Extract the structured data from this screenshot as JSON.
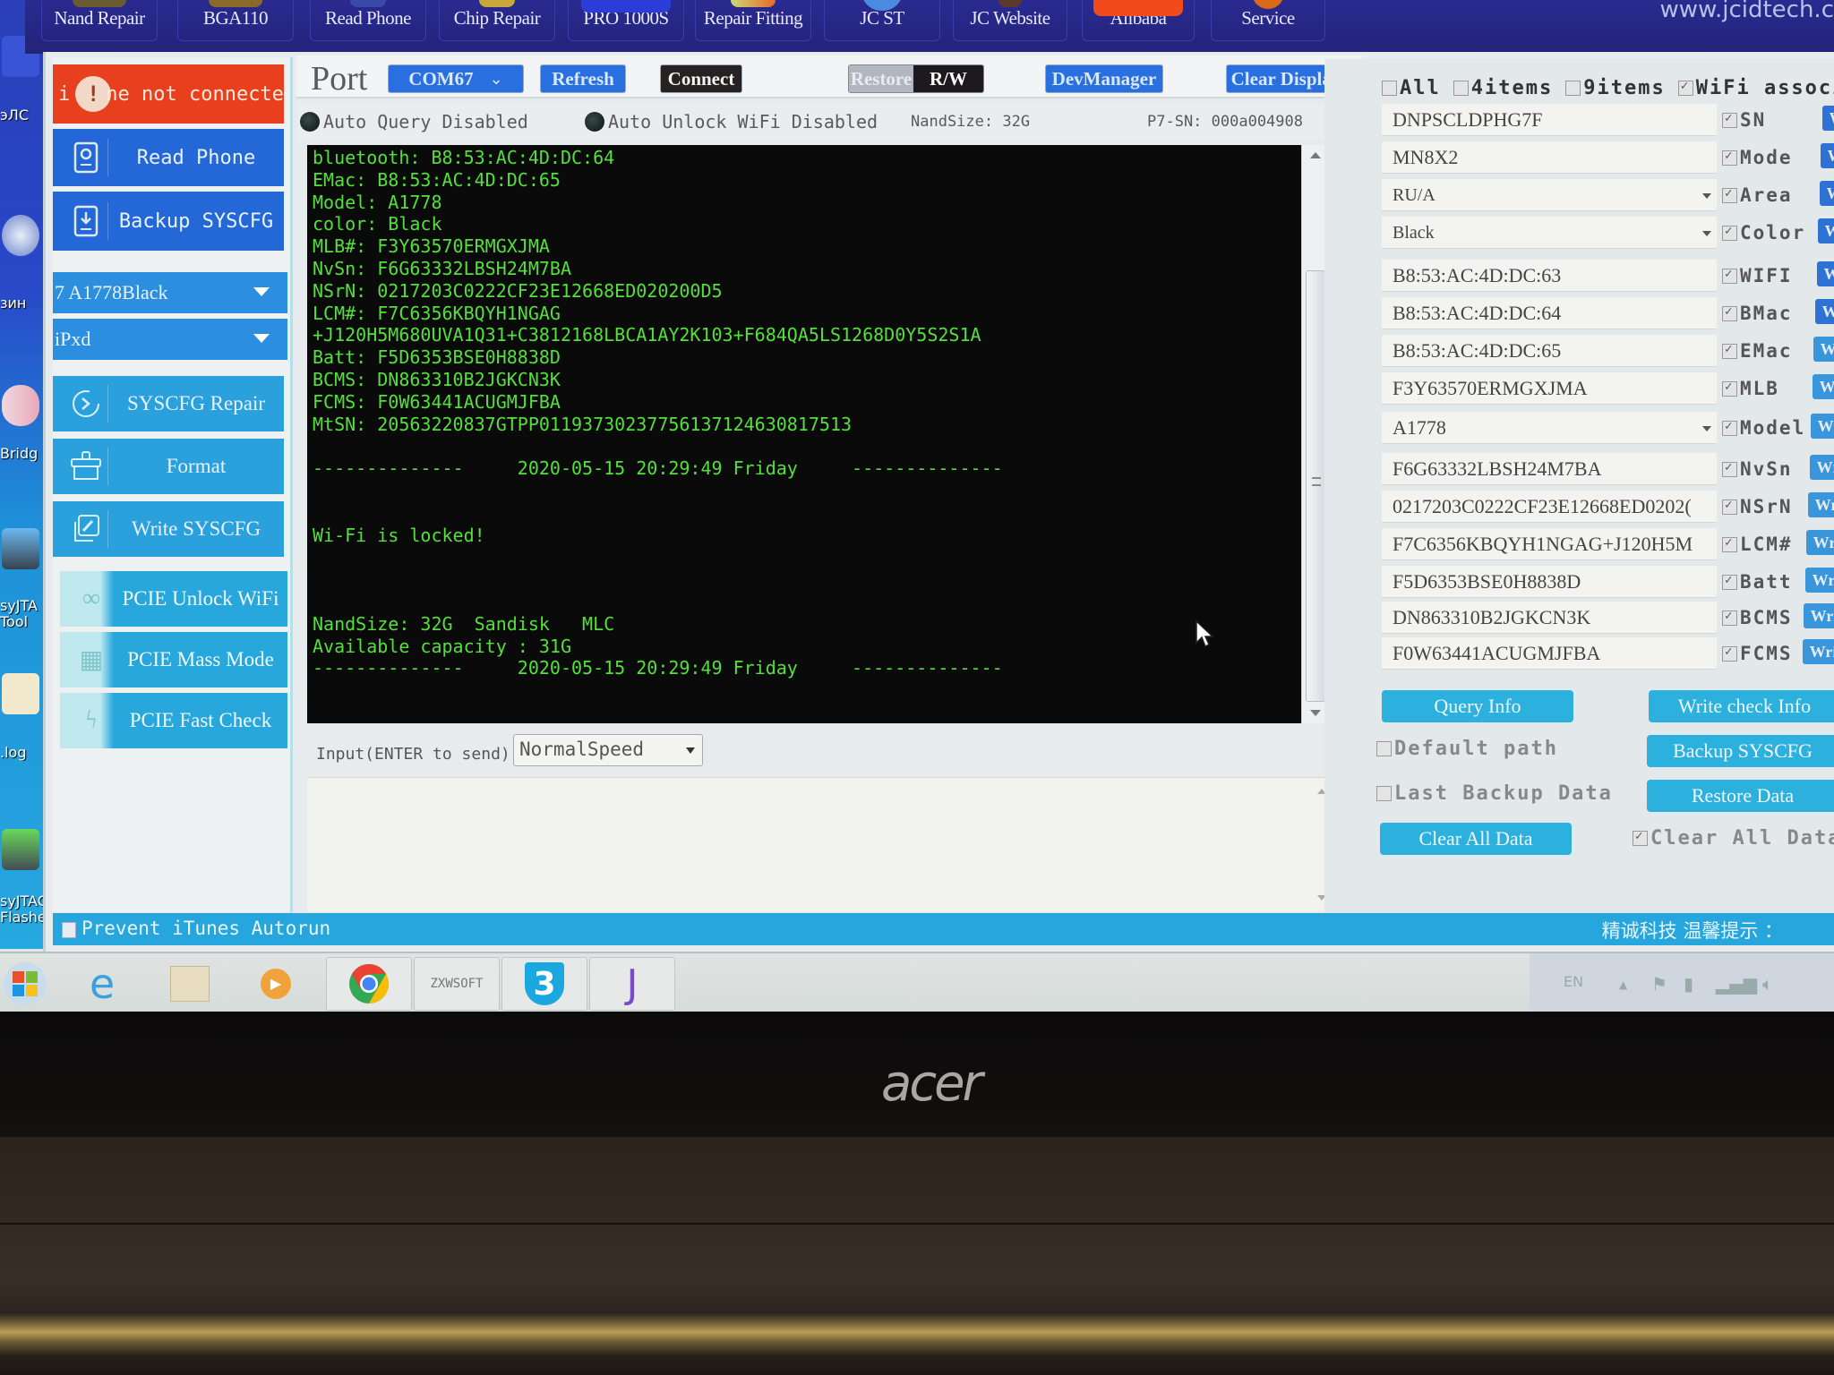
{
  "desktop": {
    "labels": [
      "эЛС",
      "зин",
      "Bridg",
      "syJTA\nTool",
      ".log",
      "syJTAG\nFlashe"
    ]
  },
  "top_menu": {
    "items": [
      {
        "label": "Nand Repair",
        "icon": "nand-repair-icon"
      },
      {
        "label": "BGA110",
        "icon": "bga-icon"
      },
      {
        "label": "Read Phone",
        "icon": "read-phone-icon"
      },
      {
        "label": "Chip Repair",
        "icon": "chip-icon"
      },
      {
        "label": "PRO 1000S",
        "icon": "pro-1000s-icon"
      },
      {
        "label": "Repair Fitting",
        "icon": "repair-fitting-icon"
      },
      {
        "label": "JC ST",
        "icon": "jc-st-icon"
      },
      {
        "label": "JC Website",
        "icon": "jc-website-icon"
      },
      {
        "label": "Alibaba",
        "icon": "alibaba-icon"
      },
      {
        "label": "Service",
        "icon": "service-icon"
      }
    ],
    "url": "www.jcidtech.c"
  },
  "sidebar": {
    "status": {
      "prefix": "i",
      "text": "ne not connecte",
      "color": "#e83f1e"
    },
    "buttons_top": [
      {
        "label": "Read Phone",
        "icon": "read-phone-icon"
      },
      {
        "label": "Backup SYSCFG",
        "icon": "download-icon"
      }
    ],
    "model_select": "7 A1778Black",
    "device_select": "iPxd",
    "buttons_mid": [
      {
        "label": "SYSCFG Repair",
        "icon": "arrow-circle-icon"
      },
      {
        "label": "Format",
        "icon": "brush-icon"
      },
      {
        "label": "Write SYSCFG",
        "icon": "edit-copy-icon"
      }
    ],
    "buttons_pcie": [
      {
        "label": "PCIE Unlock WiFi",
        "icon": "link-icon"
      },
      {
        "label": "PCIE Mass Mode",
        "icon": "grid-check-icon"
      },
      {
        "label": "PCIE Fast Check",
        "icon": "lightning-bubble-icon"
      }
    ]
  },
  "toolbar": {
    "port_label": "Port",
    "com_port": "COM67",
    "refresh": "Refresh",
    "connect": "Connect",
    "restore": "Restore",
    "rw": "R/W",
    "devmanager": "DevManager",
    "clear_display": "Clear Display"
  },
  "statusline": {
    "auto_query": "Auto Query Disabled",
    "auto_unlock": "Auto Unlock WiFi Disabled",
    "nand_size": "NandSize: 32G",
    "p7_sn": "P7-SN: 000a004908"
  },
  "console": {
    "lines": [
      "bluetooth: B8:53:AC:4D:DC:64",
      "EMac: B8:53:AC:4D:DC:65",
      "Model: A1778",
      "color: Black",
      "MLB#: F3Y63570ERMGXJMA",
      "NvSn: F6G63332LBSH24M7BA",
      "NSrN: 0217203C0222CF23E12668ED020200D5",
      "LCM#: F7C6356KBQYH1NGAG",
      "+J120H5M680UVA1Q31+C3812168LBCA1AY2K103+F684QA5LS1268D0Y5S2S1A",
      "Batt: F5D6353BSE0H8838D",
      "BCMS: DN863310B2JGKCN3K",
      "FCMS: F0W63441ACUGMJFBA",
      "MtSN: 20563220837GTPP01193730237756137124630817513",
      "",
      "--------------     2020-05-15 20:29:49 Friday     --------------",
      "",
      "",
      "Wi-Fi is locked!",
      "",
      "",
      "",
      "NandSize: 32G  Sandisk   MLC",
      "Available capacity : 31G",
      "--------------     2020-05-15 20:29:49 Friday     --------------"
    ],
    "text_color": "#53e03a"
  },
  "input": {
    "label": "Input(ENTER to send)",
    "speed": "NormalSpeed"
  },
  "right_panel": {
    "select_options": [
      {
        "label": "All",
        "checked": false
      },
      {
        "label": "4items",
        "checked": false
      },
      {
        "label": "9items",
        "checked": false
      },
      {
        "label": "WiFi associa",
        "checked": true
      }
    ],
    "fields": [
      {
        "value": "DNPSCLDPHG7F",
        "label": "SN",
        "checked": true,
        "dropdown": false
      },
      {
        "value": "MN8X2",
        "label": "Mode",
        "checked": true,
        "dropdown": false
      },
      {
        "value": "RU/A",
        "label": "Area",
        "checked": true,
        "dropdown": true
      },
      {
        "value": "Black",
        "label": "Color",
        "checked": true,
        "dropdown": true
      },
      {
        "value": "B8:53:AC:4D:DC:63",
        "label": "WIFI",
        "checked": true,
        "dropdown": false
      },
      {
        "value": "B8:53:AC:4D:DC:64",
        "label": "BMac",
        "checked": true,
        "dropdown": false
      },
      {
        "value": "B8:53:AC:4D:DC:65",
        "label": "EMac",
        "checked": true,
        "dropdown": false
      },
      {
        "value": "F3Y63570ERMGXJMA",
        "label": "MLB",
        "checked": true,
        "dropdown": false
      },
      {
        "value": "A1778",
        "label": "Model",
        "checked": true,
        "dropdown": true
      },
      {
        "value": "F6G63332LBSH24M7BA",
        "label": "NvSn",
        "checked": true,
        "dropdown": false
      },
      {
        "value": "0217203C0222CF23E12668ED0202(",
        "label": "NSrN",
        "checked": true,
        "dropdown": false
      },
      {
        "value": "F7C6356KBQYH1NGAG+J120H5M",
        "label": "LCM#",
        "checked": true,
        "dropdown": false
      },
      {
        "value": "F5D6353BSE0H8838D",
        "label": "Batt",
        "checked": true,
        "dropdown": false
      },
      {
        "value": "DN863310B2JGKCN3K",
        "label": "BCMS",
        "checked": true,
        "dropdown": false
      },
      {
        "value": "F0W63441ACUGMJFBA",
        "label": "FCMS",
        "checked": true,
        "dropdown": false
      }
    ],
    "write_label": "Write",
    "query_info": "Query Info",
    "write_check_info": "Write check Info",
    "default_path": {
      "label": "Default path",
      "checked": false
    },
    "backup_syscfg": "Backup SYSCFG",
    "last_backup": {
      "label": "Last Backup Data",
      "checked": false
    },
    "restore_data": "Restore Data",
    "clear_all_button": "Clear All Data",
    "clear_all_check": {
      "label": "Clear All Data",
      "checked": true
    }
  },
  "app_status": {
    "prevent_itunes": "Prevent iTunes Autorun",
    "prevent_itunes_checked": false,
    "tip": "精诚科技 温馨提示 ："
  },
  "taskbar": {
    "apps": [
      "start-orb",
      "internet-explorer",
      "file-explorer",
      "media-player",
      "chrome",
      "ZXWSOFT",
      "3uTools",
      "jc-app"
    ],
    "zxw_label": "ZXWSOFT",
    "three_label": "3",
    "lang": "EN"
  },
  "bezel": {
    "brand": "acer"
  }
}
